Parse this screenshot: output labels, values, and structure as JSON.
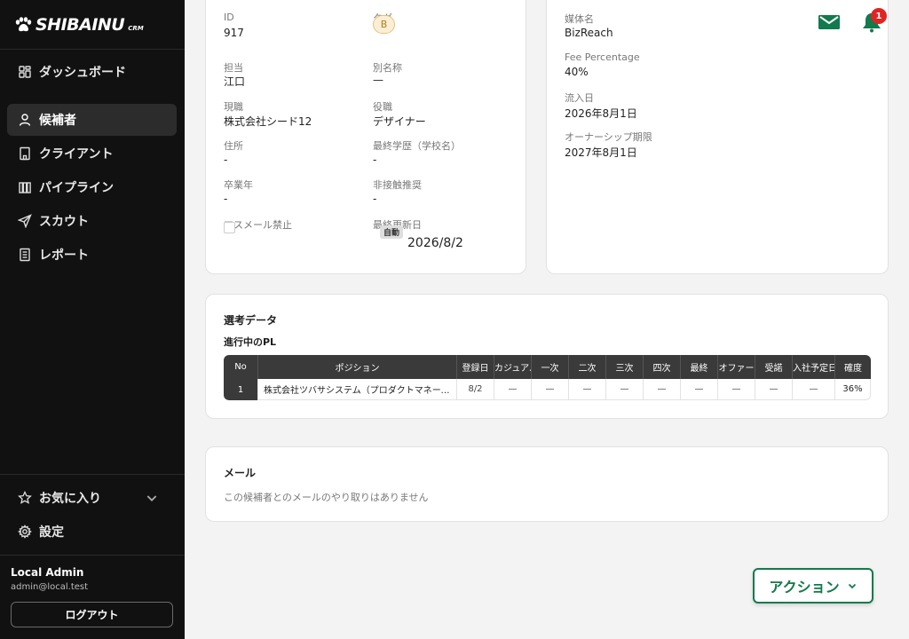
{
  "app": {
    "logo": "SHIBAINU",
    "logo_sub": "CRM"
  },
  "sidebar": {
    "items": [
      {
        "label": "ダッシュボード",
        "icon": "dashboard-icon"
      },
      {
        "label": "候補者",
        "icon": "person-icon",
        "active": true
      },
      {
        "label": "クライアント",
        "icon": "building-icon"
      },
      {
        "label": "パイプライン",
        "icon": "columns-icon"
      },
      {
        "label": "スカウト",
        "icon": "send-icon"
      },
      {
        "label": "レポート",
        "icon": "report-icon"
      }
    ],
    "favorites": "お気に入り",
    "settings": "設定",
    "user": {
      "name": "Local Admin",
      "email": "admin@local.test"
    },
    "logout": "ログアウト"
  },
  "profile": {
    "id_label": "ID",
    "id": "917",
    "tag_label": "タグ",
    "tag": "B",
    "owner_label": "担当",
    "owner": "江口",
    "alias_label": "別名称",
    "alias": "—",
    "current_label": "現職",
    "current": "株式会社シード12",
    "role_label": "役職",
    "role": "デザイナー",
    "address_label": "住所",
    "address": "-",
    "education_label": "最終学歴（学校名）",
    "education": "-",
    "grad_label": "卒業年",
    "grad": "-",
    "no_contact_label": "非接触推奨",
    "no_contact": "-",
    "mass_mail_label": "マスメール禁止",
    "updated_label": "最終更新日",
    "updated_badge": "自動",
    "updated": "2026/8/2"
  },
  "media": {
    "media_label": "媒体名",
    "media": "BizReach",
    "fee_label": "Fee Percentage",
    "fee": "40%",
    "inflow_label": "流入日",
    "inflow": "2026年8月1日",
    "ownership_label": "オーナーシップ期限",
    "ownership": "2027年8月1日",
    "notification_count": "1"
  },
  "selection": {
    "title": "選考データ",
    "subtitle": "進行中のPL",
    "headers": [
      "No",
      "ポジション",
      "登録日",
      "カジュアル",
      "一次",
      "二次",
      "三次",
      "四次",
      "最終",
      "オファー",
      "受諾",
      "入社予定日",
      "確度"
    ],
    "rows": [
      [
        "1",
        "株式会社ツバサシステム（プロダクトマネージャー）",
        "8/2",
        "—",
        "—",
        "—",
        "—",
        "—",
        "—",
        "—",
        "—",
        "—",
        "36%"
      ]
    ]
  },
  "mail": {
    "title": "メール",
    "empty": "この候補者とのメールのやり取りはありません"
  },
  "action_label": "アクション",
  "colors": {
    "accent": "#137a4d",
    "sidebar_bg": "#111111",
    "badge": "#e02424",
    "tag_bg": "#fbeed6"
  }
}
